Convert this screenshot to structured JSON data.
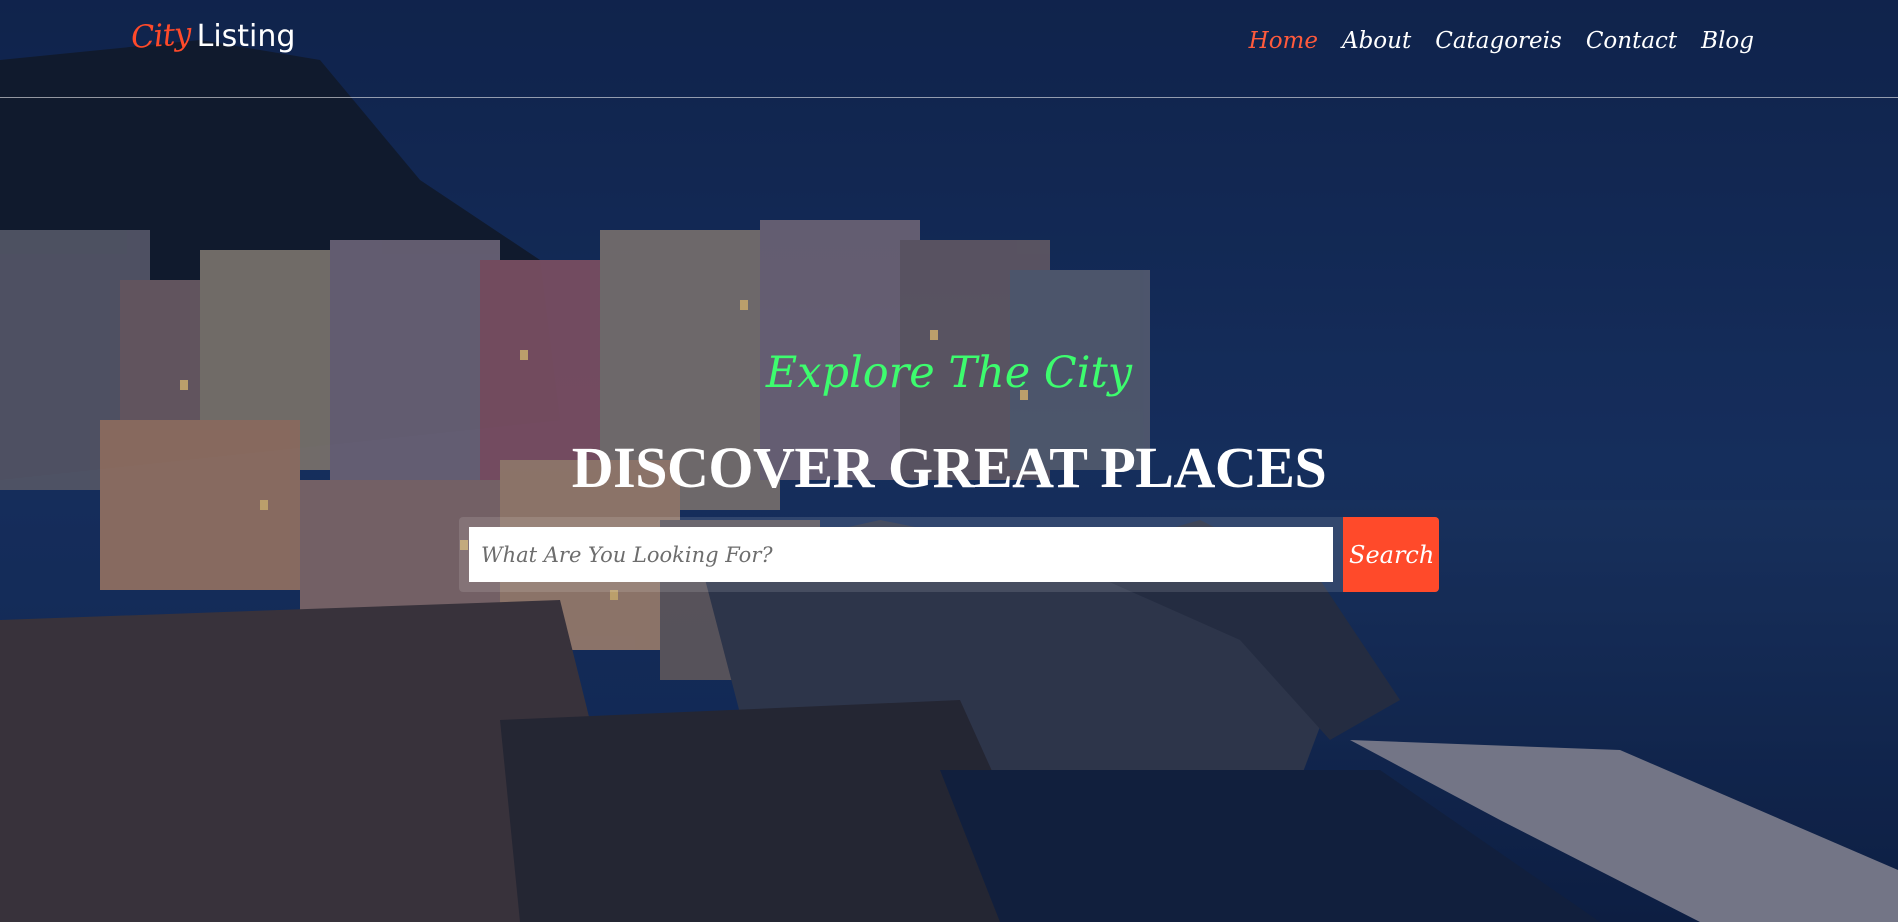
{
  "logo": {
    "part1": "City",
    "part2": "Listing"
  },
  "nav": {
    "items": [
      {
        "label": "Home",
        "active": true
      },
      {
        "label": "About"
      },
      {
        "label": "Catagoreis"
      },
      {
        "label": "Contact"
      },
      {
        "label": "Blog"
      }
    ]
  },
  "hero": {
    "tagline": "Explore The City",
    "headline": "DISCOVER GREAT PLACES"
  },
  "search": {
    "placeholder": "What Are You Looking For?",
    "value": "",
    "button_label": "Search"
  },
  "colors": {
    "accent": "#ff4a2a",
    "tagline": "#3dfc6e",
    "nav_active": "#ff5a3c"
  }
}
